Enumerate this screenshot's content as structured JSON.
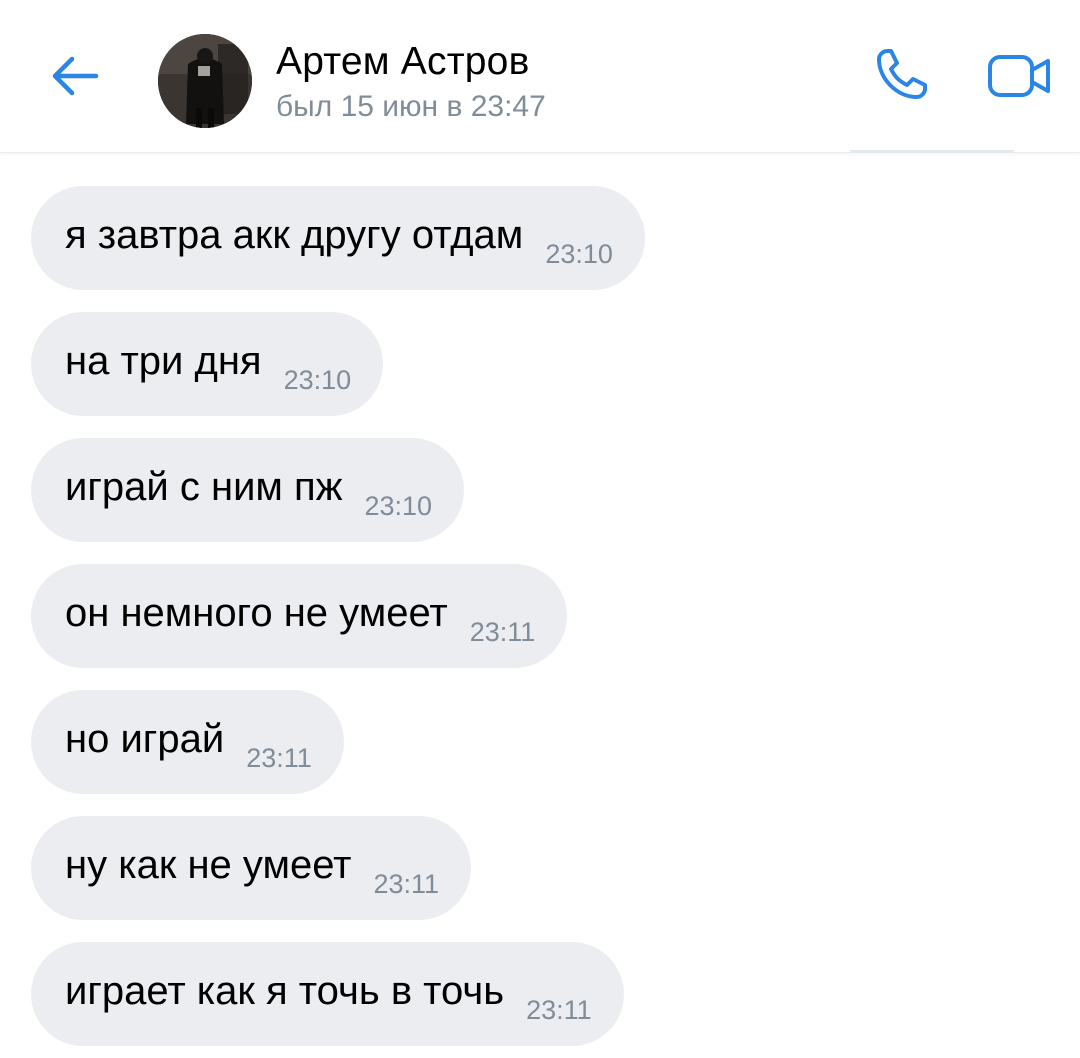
{
  "header": {
    "contact_name": "Артем Астров",
    "status": "был 15 июн в 23:47",
    "icons": {
      "back": "arrow-left-icon",
      "call": "phone-icon",
      "video": "video-camera-icon"
    }
  },
  "colors": {
    "accent": "#2a86e6",
    "bubble_bg": "#ebedf0",
    "muted_text": "#818c99",
    "text": "#000000"
  },
  "messages": [
    {
      "text": "я завтра акк другу отдам",
      "time": "23:10"
    },
    {
      "text": "на три дня",
      "time": "23:10"
    },
    {
      "text": "играй с ним пж",
      "time": "23:10"
    },
    {
      "text": "он немного не умеет",
      "time": "23:11"
    },
    {
      "text": "но играй",
      "time": "23:11"
    },
    {
      "text": "ну как не умеет",
      "time": "23:11"
    },
    {
      "text": "играет как я точь в точь",
      "time": "23:11"
    }
  ]
}
